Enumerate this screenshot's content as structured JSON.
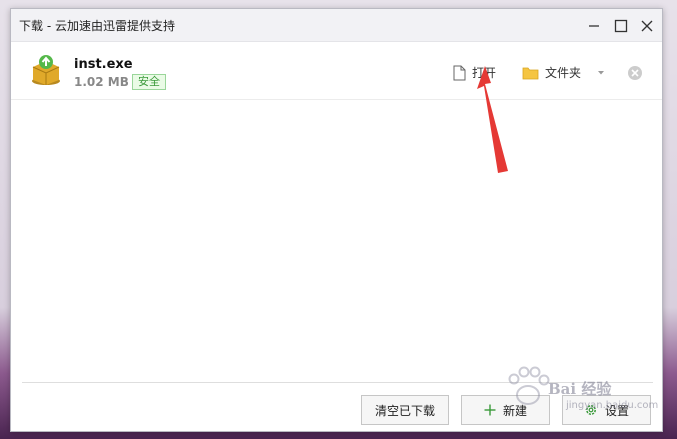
{
  "window": {
    "title": "下载 - 云加速由迅雷提供支持"
  },
  "download_item": {
    "file_name": "inst.exe",
    "file_size": "1.02 MB",
    "badge": "安全",
    "open_label": "打开",
    "folder_label": "文件夹"
  },
  "footer": {
    "clear_label": "清空已下载",
    "new_label": "新建",
    "settings_label": "设置"
  },
  "watermark": {
    "text": "Bai 经验",
    "sub": "jingyan.baidu.com"
  },
  "colors": {
    "accent_green": "#3a9a3a",
    "folder_yellow": "#f5c542",
    "annotation_red": "#e53935"
  },
  "icons": [
    "minimize-icon",
    "maximize-icon",
    "close-icon",
    "package-icon",
    "document-icon",
    "folder-icon",
    "chevron-down-icon",
    "remove-icon",
    "plus-icon",
    "gear-icon"
  ]
}
